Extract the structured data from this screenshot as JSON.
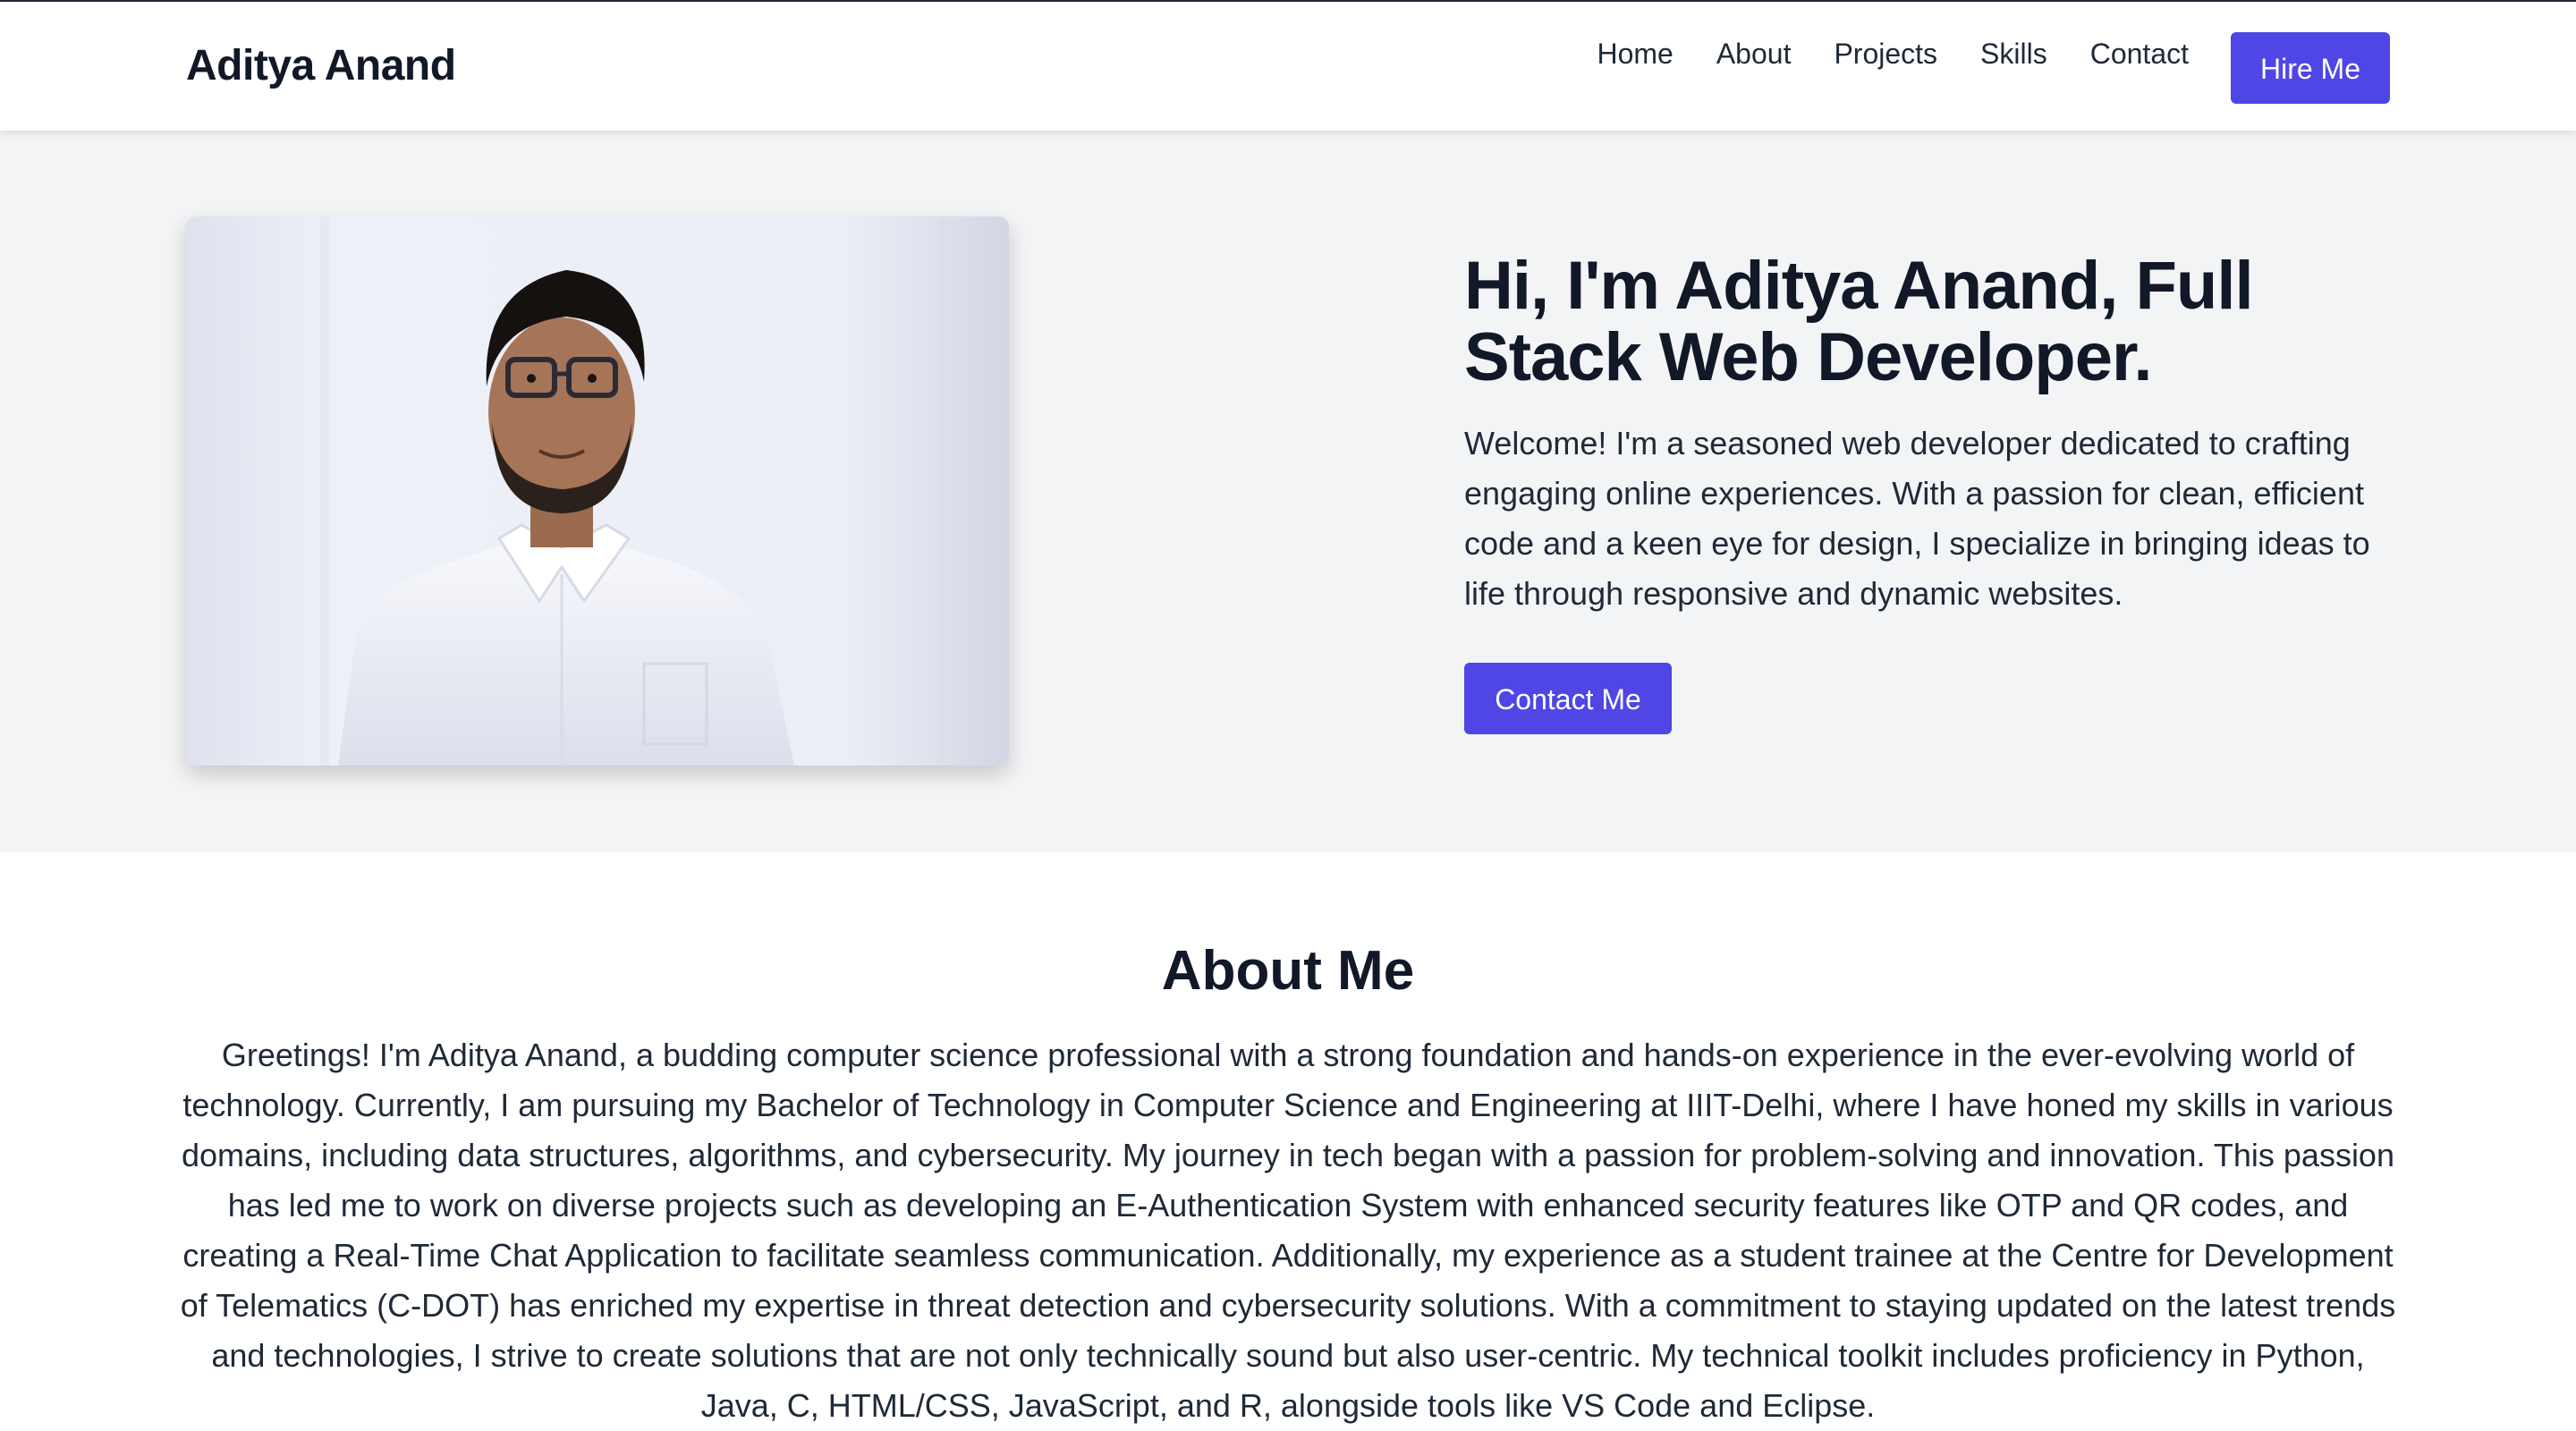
{
  "nav": {
    "brand": "Aditya Anand",
    "links": [
      "Home",
      "About",
      "Projects",
      "Skills",
      "Contact"
    ],
    "hire_label": "Hire Me"
  },
  "hero": {
    "title": "Hi, I'm Aditya Anand, Full Stack Web Developer.",
    "intro": "Welcome! I'm a seasoned web developer dedicated to crafting engaging online experiences. With a passion for clean, efficient code and a keen eye for design, I specialize in bringing ideas to life through responsive and dynamic websites.",
    "cta_label": "Contact Me"
  },
  "about": {
    "title": "About Me",
    "body": "Greetings! I'm Aditya Anand, a budding computer science professional with a strong foundation and hands-on experience in the ever-evolving world of technology. Currently, I am pursuing my Bachelor of Technology in Computer Science and Engineering at IIIT-Delhi, where I have honed my skills in various domains, including data structures, algorithms, and cybersecurity. My journey in tech began with a passion for problem-solving and innovation. This passion has led me to work on diverse projects such as developing an E-Authentication System with enhanced security features like OTP and QR codes, and creating a Real-Time Chat Application to facilitate seamless communication. Additionally, my experience as a student trainee at the Centre for Development of Telematics (C-DOT) has enriched my expertise in threat detection and cybersecurity solutions. With a commitment to staying updated on the latest trends and technologies, I strive to create solutions that are not only technically sound but also user-centric. My technical toolkit includes proficiency in Python, Java, C, HTML/CSS, JavaScript, and R, alongside tools like VS Code and Eclipse."
  },
  "colors": {
    "accent": "#4f46e5",
    "hero_bg": "#f3f4f6",
    "text": "#111827"
  }
}
